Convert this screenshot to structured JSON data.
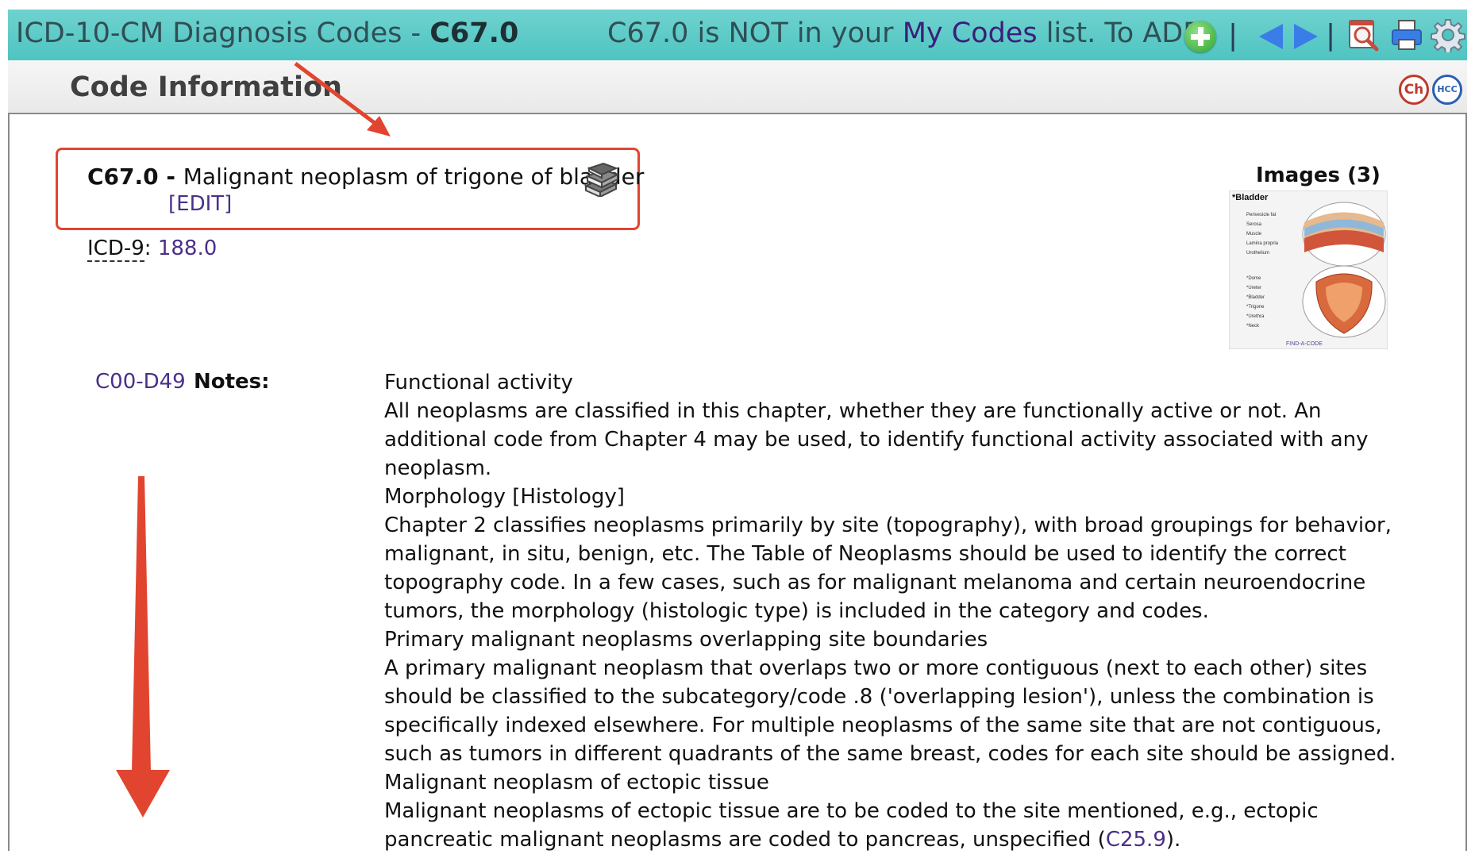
{
  "header": {
    "title_prefix": "ICD-10-CM Diagnosis Codes - ",
    "title_code": "C67.0",
    "status_code": "C67.0",
    "status_mid": " is NOT in your ",
    "my_codes_link": "My Codes",
    "status_suffix": " list. To ADD:",
    "separator": "|",
    "icons": [
      "add-icon",
      "previous-arrow-icon",
      "next-arrow-icon",
      "search-preview-icon",
      "print-icon",
      "gear-icon"
    ]
  },
  "subheader": {
    "heading": "Code Information",
    "badges": [
      "Ch",
      "HCC"
    ]
  },
  "code": {
    "code": "C67.0",
    "dash": " - ",
    "description": "Malignant neoplasm of trigone of bladder",
    "edit_label": "[EDIT]"
  },
  "icd9": {
    "label": "ICD-9",
    "colon": ": ",
    "value": "188.0"
  },
  "images": {
    "title": "Images (3)",
    "thumb_labels": [
      "*Bladder",
      "Perivesicle fat",
      "Serosa",
      "Muscle",
      "Lamina propria",
      "Urothelium",
      "*Dome",
      "*Ureter",
      "*Bladder",
      "*Trigone",
      "*Urethra",
      "*Neck",
      "FIND-A-CODE"
    ]
  },
  "notes": {
    "chapter_link": "C00-D49",
    "label": "Notes:",
    "lines": [
      "Functional activity",
      "All neoplasms are classified in this chapter, whether they are functionally active or not. An",
      "additional code from Chapter 4 may be used, to identify functional activity associated with any",
      "neoplasm.",
      "Morphology [Histology]",
      "Chapter 2 classifies neoplasms primarily by site (topography), with broad groupings for behavior,",
      "malignant, in situ, benign, etc. The Table of Neoplasms should be used to identify the correct",
      "topography code. In a few cases, such as for malignant melanoma and certain neuroendocrine",
      "tumors, the morphology (histologic type) is included in the category and codes.",
      "Primary malignant neoplasms overlapping site boundaries",
      "A primary malignant neoplasm that overlaps two or more contiguous (next to each other) sites",
      "should be classified to the subcategory/code .8 ('overlapping lesion'), unless the combination is",
      "specifically indexed elsewhere. For multiple neoplasms of the same site that are not contiguous,",
      "such as tumors in different quadrants of the same breast, codes for each site should be assigned.",
      "Malignant neoplasm of ectopic tissue",
      "Malignant neoplasms of ectopic tissue are to be coded to the site mentioned, e.g., ectopic"
    ],
    "last_line_prefix": "pancreatic malignant neoplasms are coded to pancreas, unspecified (",
    "last_line_link": "C25.9",
    "last_line_suffix": ")."
  },
  "colors": {
    "header_teal": "#4fc4c1",
    "link_purple": "#4a2f8a",
    "annotation_red": "#e2452f"
  }
}
